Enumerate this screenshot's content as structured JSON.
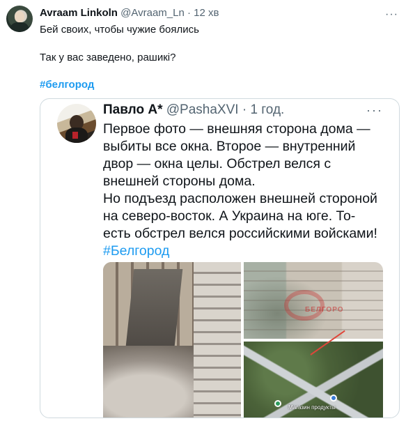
{
  "tweet": {
    "author_name": "Avraam Linkoln",
    "handle": "@Avraam_Ln",
    "separator": "·",
    "time": "12 хв",
    "more_label": "···",
    "lines": [
      "Бей своих, чтобы чужие боялись",
      "Так у вас заведено, рашикі?"
    ],
    "hashtag": "#белгород"
  },
  "quoted": {
    "author_name": "Павло А*",
    "handle": "@PashaXVI",
    "separator": "·",
    "time": "1 год.",
    "more_label": "···",
    "lines": [
      "Первое фото — внешняя сторона дома —",
      "выбиты все окна. Второе — внутренний",
      "двор — окна целы. Обстрел велся с",
      "внешней стороны дома.",
      "Но подъезд расположен внешней стороной",
      "на северо-восток. А Украина на юге. То-",
      "есть обстрел велся российскими войсками!"
    ],
    "hashtag": "#Белгород",
    "media": {
      "watermark": "БЕЛГОРО",
      "map_label": "Магазин продукты"
    }
  }
}
